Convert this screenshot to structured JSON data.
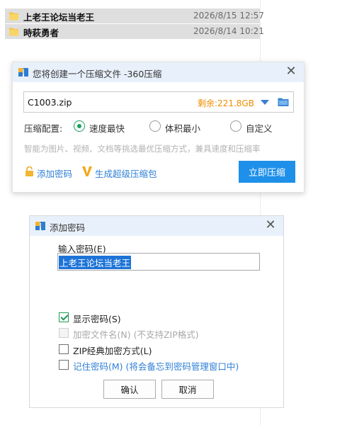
{
  "files": [
    {
      "name": "上老王论坛当老王",
      "date": "2026/8/15 12:57"
    },
    {
      "name": "時萩勇者",
      "date": "2026/8/14 10:21"
    }
  ],
  "compress_dialog": {
    "title": "您将创建一个压缩文件 -360压缩",
    "filename": "C1003.zip",
    "free_space": "剩余:221.8GB",
    "config_label": "压缩配置:",
    "options": [
      "速度最快",
      "体积最小",
      "自定义"
    ],
    "selected_option": "速度最快",
    "hint": "智能为图片、视频、文档等挑选最优压缩方式，兼具速度和压缩率",
    "add_password_link": "添加密码",
    "super_pack_link": "生成超级压缩包",
    "compress_now_button": "立即压缩",
    "accent_color": "#1e90ea"
  },
  "password_dialog": {
    "title": "添加密码",
    "input_label": "输入密码(E)",
    "password_value": "上老王论坛当老王",
    "show_password": "显示密码(S)",
    "encrypt_filename": "加密文件名(N) (不支持ZIP格式)",
    "zip_classic": "ZIP经典加密方式(L)",
    "remember_password": "记住密码(M) (将会备忘到密码管理窗口中)",
    "ok_button": "确认",
    "cancel_button": "取消"
  }
}
